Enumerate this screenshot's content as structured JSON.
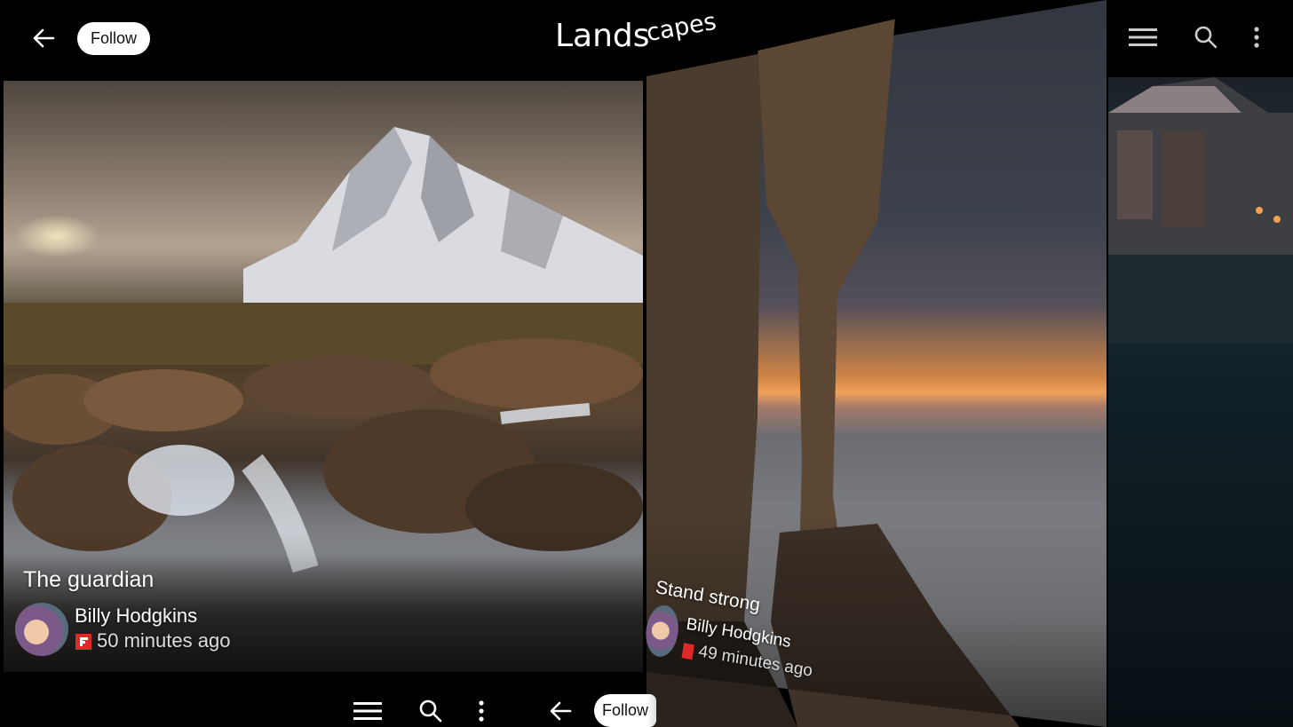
{
  "app": "Flipboard",
  "magazine": {
    "title_main": "Lands",
    "title_tail": "capes",
    "title_full": "Landscapes"
  },
  "header": {
    "back_icon": "arrow-left-icon",
    "follow_label": "Follow"
  },
  "right_toolbar": {
    "icons": [
      "menu-icon",
      "search-icon",
      "more-vert-icon"
    ]
  },
  "pages": [
    {
      "title": "The guardian",
      "author": "Billy Hodgkins",
      "source_badge": "flipboard-icon",
      "time": "50 minutes ago"
    },
    {
      "title": "Stand strong",
      "author": "Billy Hodgkins",
      "source_badge": "flipboard-icon",
      "time": "49 minutes ago"
    }
  ],
  "bottom_toolbar": {
    "icons": [
      "menu-icon",
      "search-icon",
      "more-vert-icon",
      "arrow-left-icon"
    ],
    "follow_label": "Follow"
  },
  "colors": {
    "badge_red": "#e12828",
    "follow_bg": "#ffffff",
    "follow_text": "#111111"
  }
}
